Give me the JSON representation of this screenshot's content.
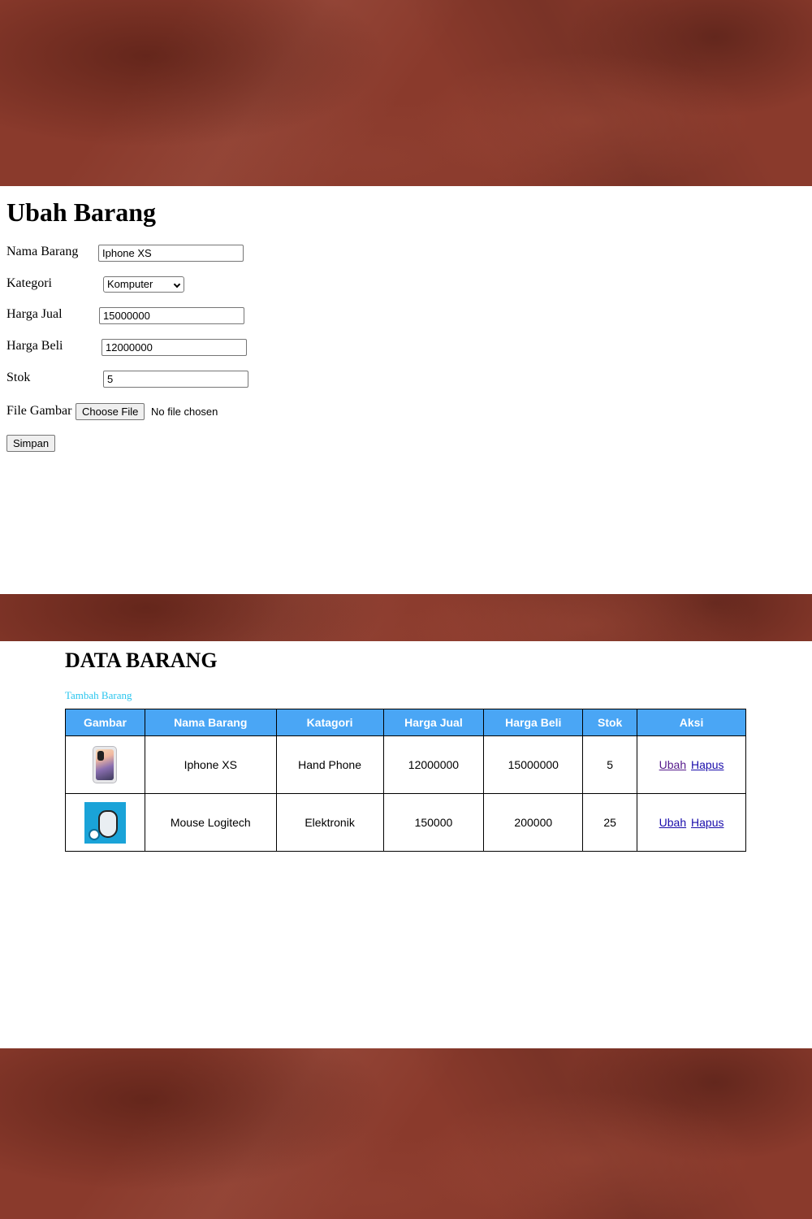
{
  "form": {
    "title": "Ubah Barang",
    "fields": {
      "nama_barang": {
        "label": "Nama Barang",
        "value": "Iphone XS"
      },
      "kategori": {
        "label": "Kategori",
        "selected": "Komputer"
      },
      "harga_jual": {
        "label": "Harga Jual",
        "value": "15000000"
      },
      "harga_beli": {
        "label": "Harga Beli",
        "value": "12000000"
      },
      "stok": {
        "label": "Stok",
        "value": "5"
      },
      "file_gambar": {
        "label": "File Gambar",
        "button_label": "Choose File",
        "status": "No file chosen"
      }
    },
    "submit_label": "Simpan"
  },
  "data": {
    "title": "DATA BARANG",
    "add_link": "Tambah Barang",
    "headers": {
      "gambar": "Gambar",
      "nama": "Nama Barang",
      "kategori": "Katagori",
      "harga_jual": "Harga Jual",
      "harga_beli": "Harga Beli",
      "stok": "Stok",
      "aksi": "Aksi"
    },
    "rows": [
      {
        "image": "iphone-xs-image",
        "nama": "Iphone XS",
        "kategori": "Hand Phone",
        "harga_jual": "12000000",
        "harga_beli": "15000000",
        "stok": "5",
        "edit": "Ubah",
        "delete": "Hapus"
      },
      {
        "image": "logitech-mouse-image",
        "nama": "Mouse Logitech",
        "kategori": "Elektronik",
        "harga_jual": "150000",
        "harga_beli": "200000",
        "stok": "25",
        "edit": "Ubah",
        "delete": "Hapus"
      }
    ]
  },
  "colors": {
    "banner": "#8a3a2c",
    "table_header": "#4aa6f5",
    "add_link": "#29c5ee",
    "link": "#1a0dab",
    "visited_link": "#551a8b"
  }
}
